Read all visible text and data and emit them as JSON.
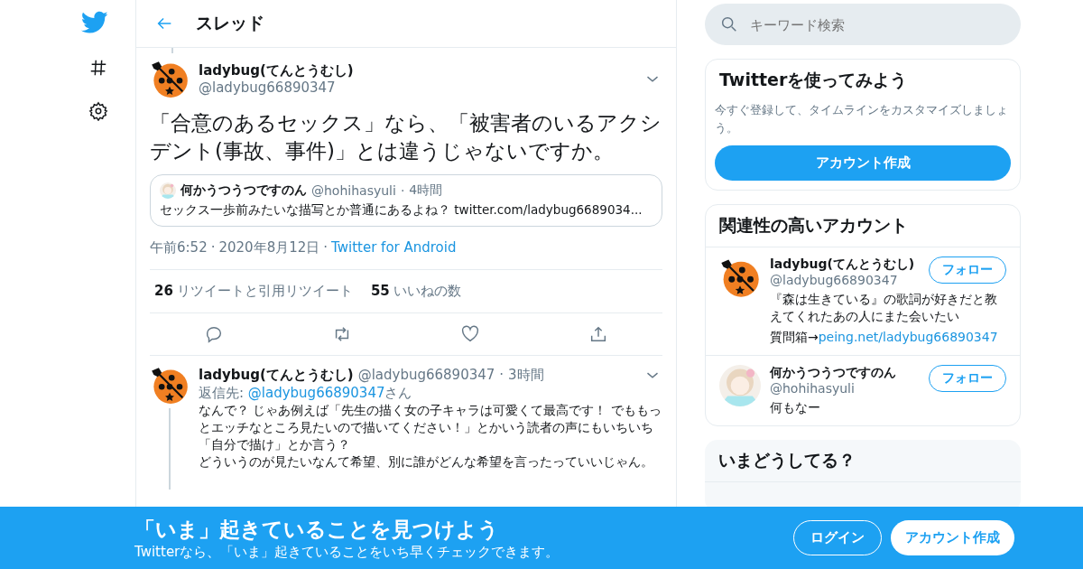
{
  "header": {
    "title": "スレッド"
  },
  "main_tweet": {
    "name": "ladybug(てんとうむし)",
    "handle": "@ladybug66890347",
    "text": "「合意のあるセックス」なら、「被害者のいるアクシデント(事故、事件)」とは違うじゃないですか。",
    "quote": {
      "name": "何かうつうつですのん",
      "handle": "@hohihasyuli",
      "separator": "·",
      "time": "4時間",
      "text": "セックス一歩前みたいな描写とか普通にあるよね？ twitter.com/ladybug6689034..."
    },
    "time": "午前6:52",
    "separator_1": "·",
    "date": "2020年8月12日",
    "separator_2": "·",
    "source": "Twitter for Android",
    "stats": [
      {
        "count": "26",
        "label": "リツイートと引用リツイート"
      },
      {
        "count": "55",
        "label": "いいねの数"
      }
    ]
  },
  "reply": {
    "name": "ladybug(てんとうむし)",
    "handle": "@ladybug66890347",
    "separator": "·",
    "time": "3時間",
    "reply_label": "返信先: ",
    "reply_to": "@ladybug66890347",
    "reply_suffix": "さん",
    "paragraphs": [
      "なんで？ じゃあ例えば「先生の描く女の子キャラは可愛くて最高です！ でももっとエッチなところ見たいので描いてください！」とかいう読者の声にもいちいち「自分で描け」とか言う？",
      "どういうのが見たいなんて希望、別に誰がどんな希望を言ったっていいじゃん。"
    ]
  },
  "search": {
    "placeholder": "キーワード検索"
  },
  "signup_card": {
    "title": "Twitterを使ってみよう",
    "text": "今すぐ登録して、タイムラインをカスタマイズしましょう。",
    "button": "アカウント作成"
  },
  "related": {
    "title": "関連性の高いアカウント",
    "accounts": [
      {
        "kind": "ladybug",
        "name": "ladybug(てんとうむし)",
        "handle": "@ladybug66890347",
        "bio": [
          "『森は生きている』の歌詞が好きだと教えてくれたあの人にまた会いたい",
          "質問箱→"
        ],
        "link": "peing.net/ladybug66890347",
        "button": "フォロー"
      },
      {
        "kind": "picture",
        "name": "何かうつうつですのん",
        "handle": "@hohihasyuli",
        "bio": [
          "何もなー"
        ],
        "button": "フォロー"
      }
    ]
  },
  "trends": {
    "title": "いまどうしてる？"
  },
  "banner": {
    "title": "「いま」起きていることを見つけよう",
    "text": "Twitterなら、「いま」起きていることをいち早くチェックできます。",
    "login": "ログイン",
    "signup": "アカウント作成"
  }
}
